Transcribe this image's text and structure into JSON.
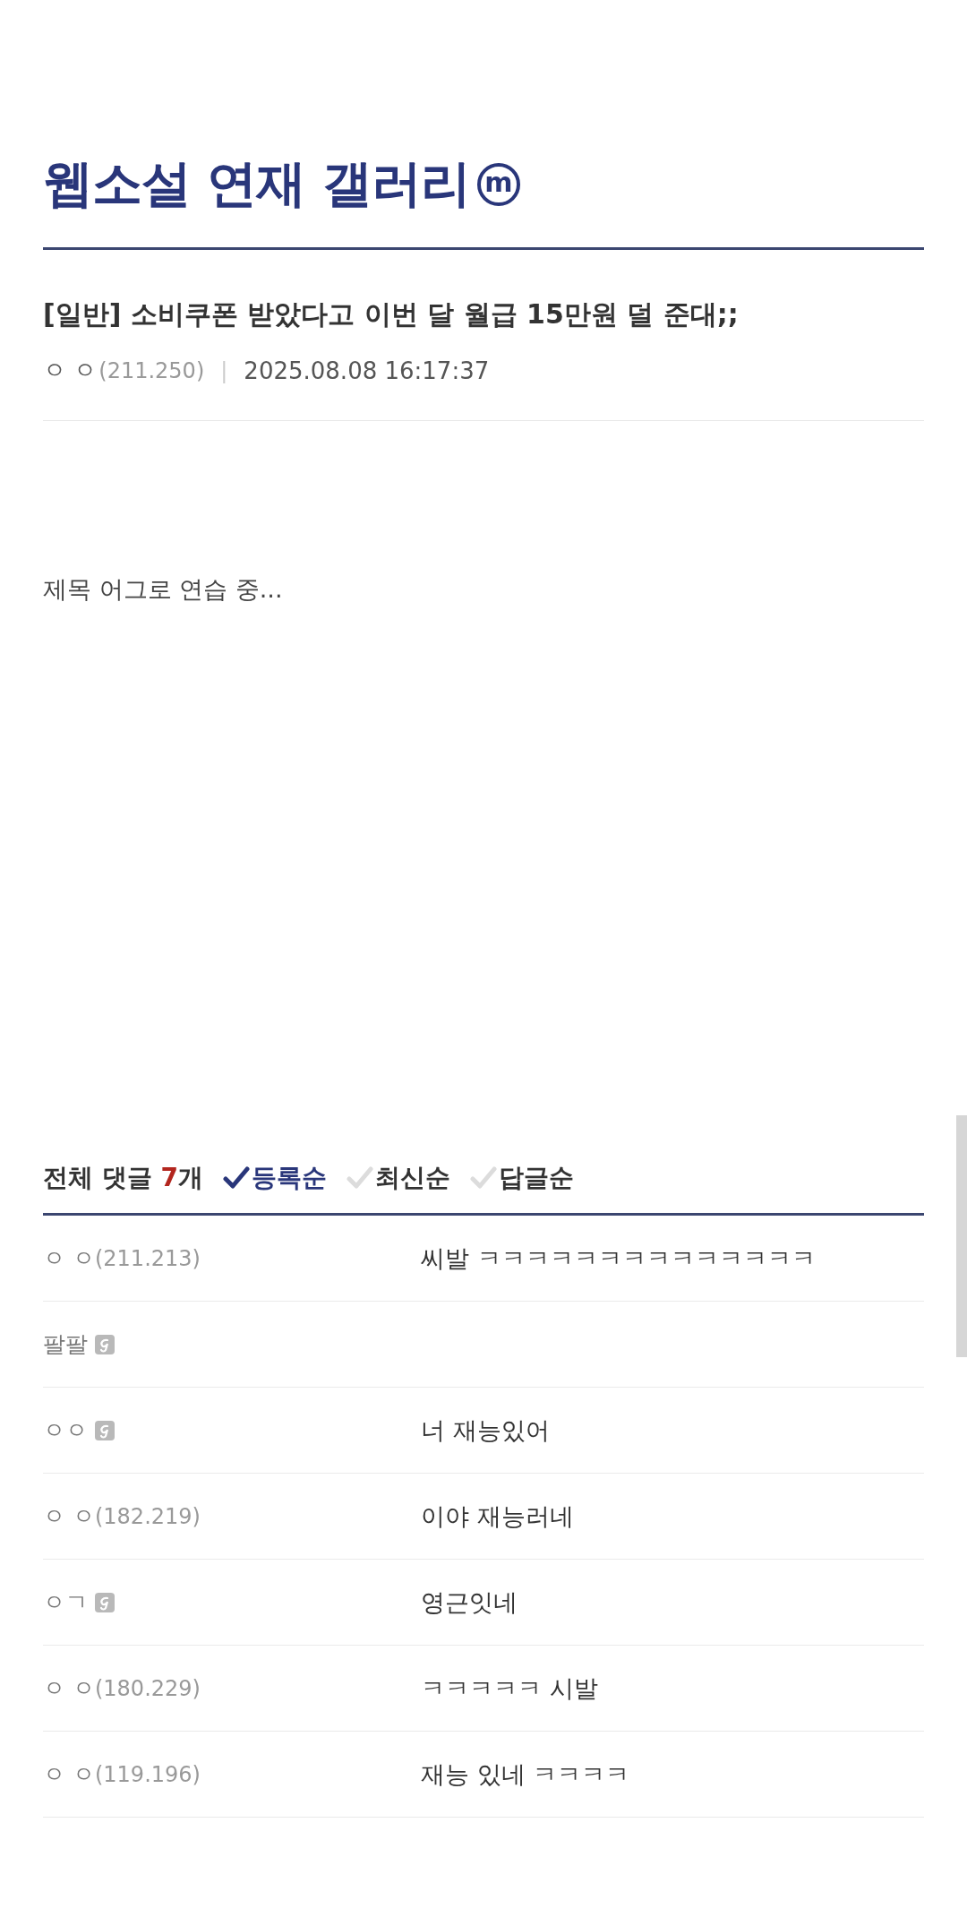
{
  "gallery": {
    "title": "웹소설 연재 갤러리",
    "badge": "m"
  },
  "post": {
    "title": "[일반] 소비쿠폰 받았다고 이번 달 월급 15만원 덜 준대;;",
    "author": "ㅇ ㅇ",
    "ip": "(211.250)",
    "separator": "|",
    "date": "2025.08.08 16:17:37",
    "body": "제목 어그로 연습 중..."
  },
  "comments": {
    "label": "전체 댓글",
    "count": "7",
    "count_unit": "개",
    "sort_options": [
      {
        "label": "등록순",
        "selected": true
      },
      {
        "label": "최신순",
        "selected": false
      },
      {
        "label": "답글순",
        "selected": false
      }
    ],
    "items": [
      {
        "author": "ㅇ ㅇ",
        "ip": "(211.213)",
        "fixed_nick": false,
        "text": "씨발 ㅋㅋㅋㅋㅋㅋㅋㅋㅋㅋㅋㅋㅋㅋ"
      },
      {
        "author": "팔팔",
        "fixed_nick": true
      },
      {
        "author": "ㅇㅇ",
        "fixed_nick": true,
        "text": "너 재능있어"
      },
      {
        "author": "ㅇ ㅇ",
        "ip": "(182.219)",
        "fixed_nick": false,
        "text": "이야 재능러네"
      },
      {
        "author": "ㅇㄱ",
        "fixed_nick": true,
        "text": "영근잇네"
      },
      {
        "author": "ㅇ ㅇ",
        "ip": "(180.229)",
        "fixed_nick": false,
        "text": "ㅋㅋㅋㅋㅋ 시발"
      },
      {
        "author": "ㅇ ㅇ",
        "ip": "(119.196)",
        "fixed_nick": false,
        "text": "재능 있네 ㅋㅋㅋㅋ"
      }
    ]
  }
}
